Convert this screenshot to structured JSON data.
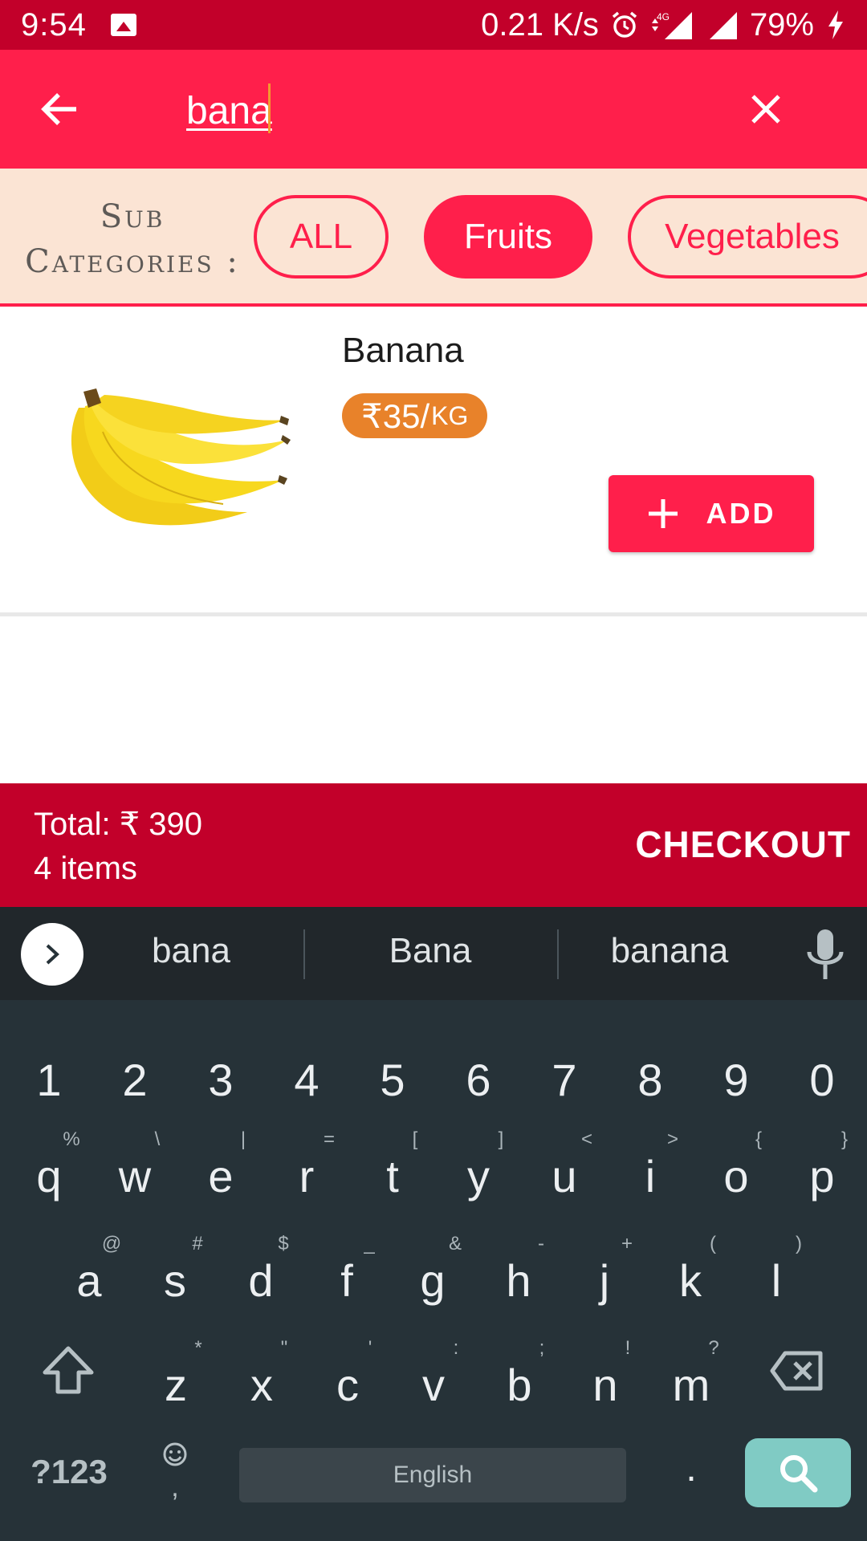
{
  "status_bar": {
    "time": "9:54",
    "speed": "0.21 K/s",
    "network": "4G",
    "battery": "79%"
  },
  "search": {
    "value": "bana"
  },
  "subcategories": {
    "label_line1": "Sub",
    "label_line2": "Categories :",
    "chips": [
      {
        "label": "ALL",
        "active": false
      },
      {
        "label": "Fruits",
        "active": true
      },
      {
        "label": "Vegetables",
        "active": false
      }
    ]
  },
  "product": {
    "name": "Banana",
    "price": "₹35/",
    "unit": "kg",
    "add_label": "ADD"
  },
  "cart": {
    "total": "Total: ₹ 390",
    "items": "4 items",
    "checkout_label": "CHECKOUT"
  },
  "keyboard": {
    "suggestions": [
      "bana",
      "Bana",
      "banana"
    ],
    "number_row": [
      "1",
      "2",
      "3",
      "4",
      "5",
      "6",
      "7",
      "8",
      "9",
      "0"
    ],
    "row1": {
      "keys": [
        "q",
        "w",
        "e",
        "r",
        "t",
        "y",
        "u",
        "i",
        "o",
        "p"
      ],
      "hints": [
        "%",
        "\\",
        "|",
        "=",
        "[",
        "]",
        "<",
        ">",
        "{",
        "}"
      ]
    },
    "row2": {
      "keys": [
        "a",
        "s",
        "d",
        "f",
        "g",
        "h",
        "j",
        "k",
        "l"
      ],
      "hints": [
        "@",
        "#",
        "$",
        "_",
        "&",
        "-",
        "+",
        "(",
        ")"
      ]
    },
    "row3": {
      "keys": [
        "z",
        "x",
        "c",
        "v",
        "b",
        "n",
        "m"
      ],
      "hints": [
        "*",
        "\"",
        "'",
        ":",
        ";",
        "!",
        "?"
      ]
    },
    "symbols_label": "?123",
    "space_label": "English",
    "period_label": ".",
    "emoji_comma": ","
  },
  "colors": {
    "primary": "#ff1f4b",
    "dark_primary": "#c2002a",
    "subcategory_bg": "#fbe4d4",
    "price_badge": "#e8822a",
    "keyboard_bg": "#263238",
    "search_key": "#80cbc4"
  }
}
